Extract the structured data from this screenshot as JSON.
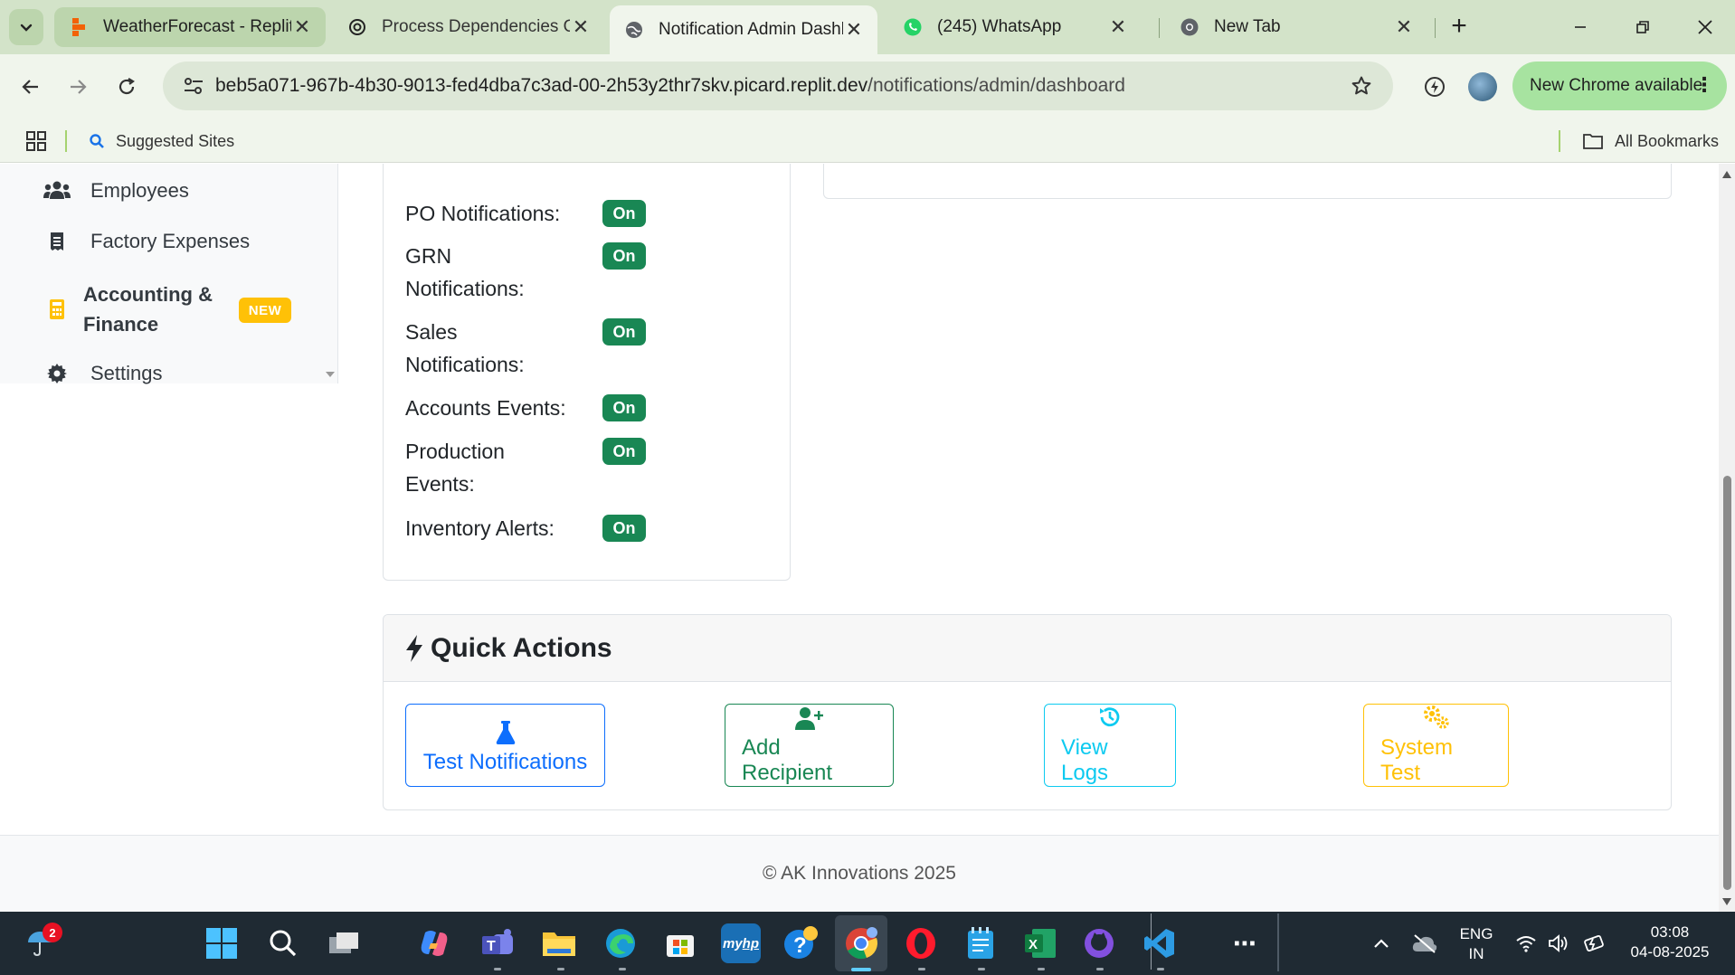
{
  "browser": {
    "tabs": [
      {
        "title": "WeatherForecast - Replit",
        "favicon": "replit-icon"
      },
      {
        "title": "Process Dependencies Ov",
        "favicon": "chatgpt-icon"
      },
      {
        "title": "Notification Admin Dashb",
        "favicon": "globe-icon",
        "active": true
      },
      {
        "title": "(245) WhatsApp",
        "favicon": "whatsapp-icon"
      },
      {
        "title": "New Tab",
        "favicon": "chrome-icon"
      }
    ],
    "url_host": "beb5a071-967b-4b30-9013-fed4dba7c3ad-00-2h53y2thr7skv.picard.replit.dev",
    "url_path": "/notifications/admin/dashboard",
    "update_label": "New Chrome available",
    "bookmarks": {
      "suggested": "Suggested Sites",
      "all": "All Bookmarks"
    }
  },
  "sidebar": {
    "items": [
      {
        "label": "Employees",
        "icon": "users-icon"
      },
      {
        "label": "Factory Expenses",
        "icon": "receipt-icon"
      },
      {
        "label": "Accounting & Finance",
        "icon": "calculator-icon",
        "badge": "NEW"
      },
      {
        "label": "Settings",
        "icon": "gear-icon"
      }
    ]
  },
  "notification_settings": [
    {
      "label": "PO Notifications:",
      "status": "On"
    },
    {
      "label": "GRN Notifications:",
      "status": "On"
    },
    {
      "label": "Sales Notifications:",
      "status": "On"
    },
    {
      "label": "Accounts Events:",
      "status": "On"
    },
    {
      "label": "Production Events:",
      "status": "On"
    },
    {
      "label": "Inventory Alerts:",
      "status": "On"
    }
  ],
  "quick_actions": {
    "title": "Quick Actions",
    "buttons": [
      {
        "label": "Test Notifications",
        "icon": "flask-icon"
      },
      {
        "label": "Add Recipient",
        "icon": "user-plus-icon"
      },
      {
        "label": "View Logs",
        "icon": "history-icon"
      },
      {
        "label": "System Test",
        "icon": "cogs-icon"
      }
    ]
  },
  "footer": {
    "text": "© AK Innovations 2025"
  },
  "taskbar": {
    "weather_badge": "2",
    "language": "ENG",
    "region": "IN",
    "time": "03:08",
    "date": "04-08-2025"
  },
  "colors": {
    "success": "#198754",
    "primary": "#0d6efd",
    "info": "#0dcaf0",
    "warning": "#ffc107",
    "tabstrip": "#d3e3c9",
    "update_pill": "#a7e3a0"
  }
}
